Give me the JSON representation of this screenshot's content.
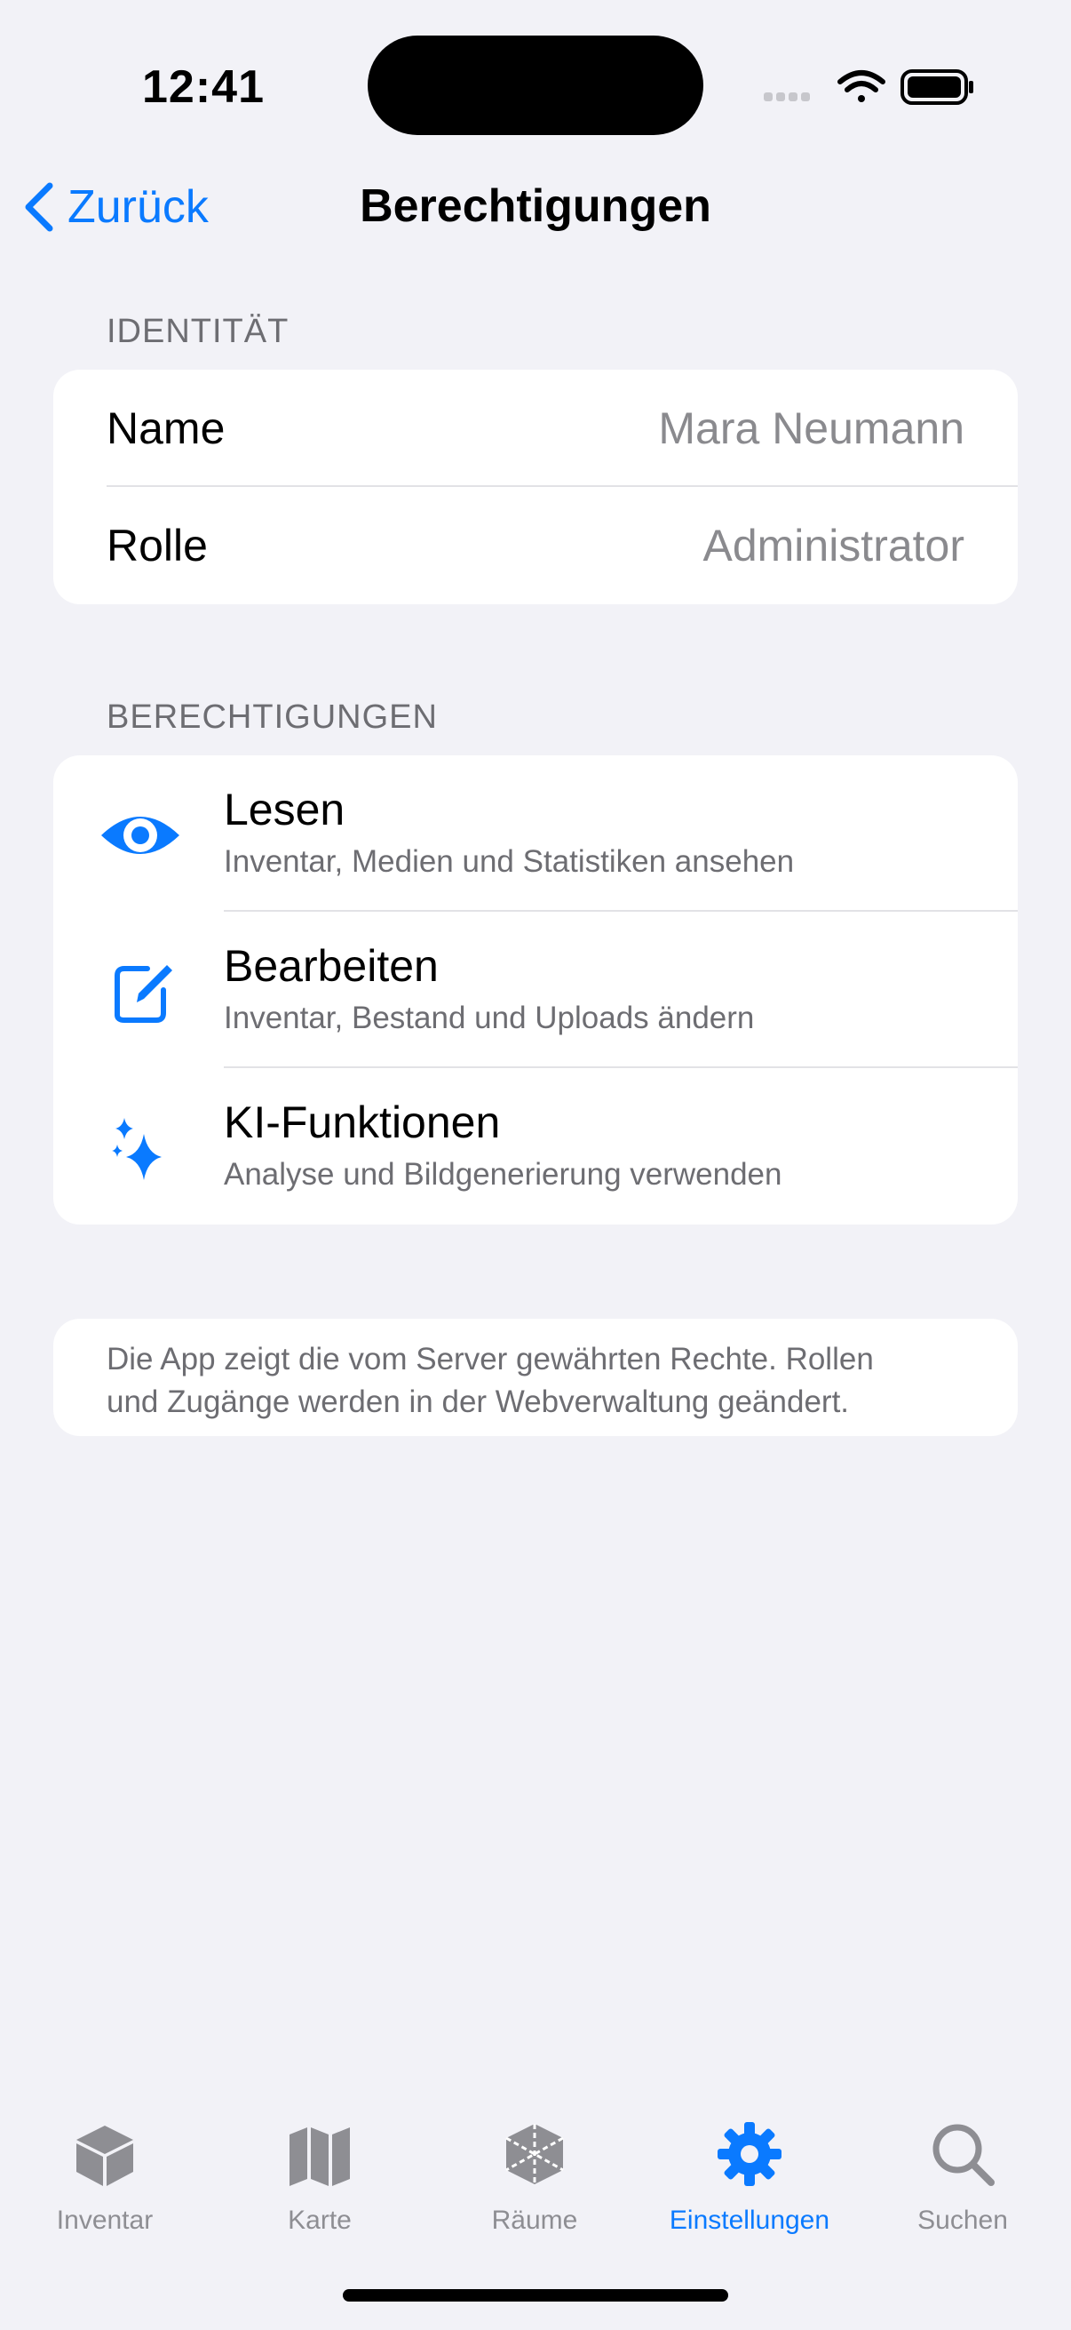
{
  "status_bar": {
    "time": "12:41"
  },
  "nav": {
    "back_label": "Zurück",
    "title": "Berechtigungen"
  },
  "identity": {
    "header": "IDENTITÄT",
    "rows": [
      {
        "label": "Name",
        "value": "Mara Neumann"
      },
      {
        "label": "Rolle",
        "value": "Administrator"
      }
    ]
  },
  "permissions": {
    "header": "BERECHTIGUNGEN",
    "items": [
      {
        "icon": "eye-icon",
        "title": "Lesen",
        "subtitle": "Inventar, Medien und Statistiken ansehen"
      },
      {
        "icon": "edit-icon",
        "title": "Bearbeiten",
        "subtitle": "Inventar, Bestand und Uploads ändern"
      },
      {
        "icon": "sparkles-icon",
        "title": "KI-Funktionen",
        "subtitle": "Analyse und Bildgenerierung verwenden"
      }
    ]
  },
  "note": {
    "line1": "Die App zeigt die vom Server gewährten Rechte. Rollen",
    "line2": "und Zugänge werden in der Webverwaltung geändert."
  },
  "tab_bar": {
    "tabs": [
      {
        "label": "Inventar",
        "icon": "box-icon",
        "active": false
      },
      {
        "label": "Karte",
        "icon": "map-icon",
        "active": false
      },
      {
        "label": "Räume",
        "icon": "rooms-icon",
        "active": false
      },
      {
        "label": "Einstellungen",
        "icon": "gear-icon",
        "active": true
      },
      {
        "label": "Suchen",
        "icon": "search-icon",
        "active": false
      }
    ]
  },
  "colors": {
    "accent": "#0a7aff",
    "background": "#f2f2f7",
    "secondary_text": "#8a8a8e"
  }
}
